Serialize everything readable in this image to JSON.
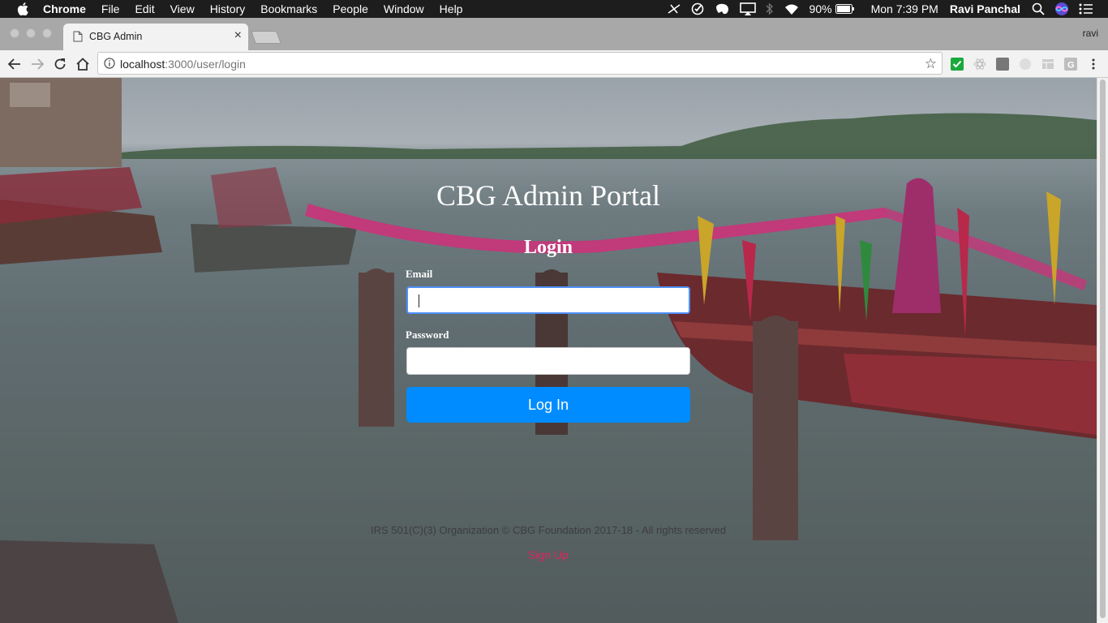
{
  "menubar": {
    "app": "Chrome",
    "items": [
      "File",
      "Edit",
      "View",
      "History",
      "Bookmarks",
      "People",
      "Window",
      "Help"
    ],
    "battery": "90%",
    "clock": "Mon 7:39 PM",
    "user": "Ravi Panchal"
  },
  "browser": {
    "tab_title": "CBG Admin",
    "profile": "ravi",
    "url_host": "localhost",
    "url_path": ":3000/user/login"
  },
  "page": {
    "site_title": "CBG Admin Portal",
    "login_title": "Login",
    "email_label": "Email",
    "email_value": "",
    "password_label": "Password",
    "password_value": "",
    "login_button": "Log In",
    "footer": "IRS 501(C)(3) Organization © CBG Foundation 2017-18 - All rights reserved",
    "signup_link": "Sign Up"
  },
  "colors": {
    "primary_button": "#008cff",
    "signup_link": "#e0245e",
    "menubar": "#1d1d1d"
  }
}
